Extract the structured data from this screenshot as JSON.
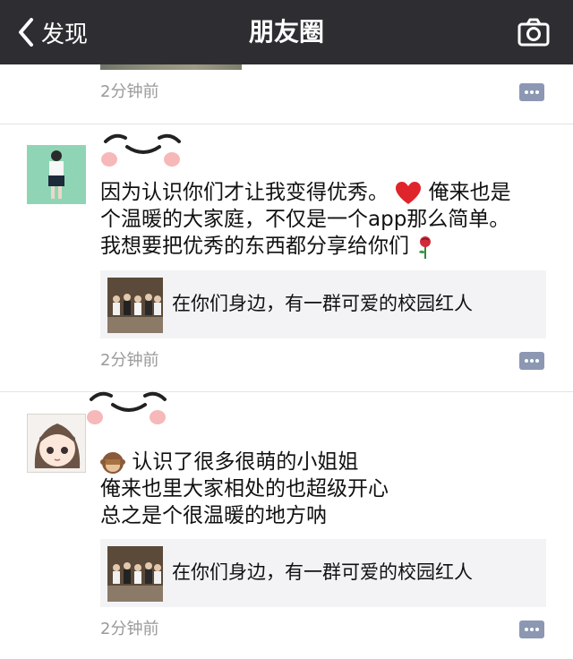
{
  "nav": {
    "back_label": "发现",
    "title": "朋友圈"
  },
  "posts": [
    {
      "time": "2分钟前"
    },
    {
      "lines": [
        "因为认识你们才让我变得优秀。",
        "俺来也是",
        "个温暖的大家庭，不仅是一个app那么简单。",
        "我想要把优秀的东西都分享给你们"
      ],
      "link": {
        "title": "在你们身边，有一群可爱的校园红人"
      },
      "time": "2分钟前"
    },
    {
      "lines": [
        "认识了很多很萌的小姐姐",
        "俺来也里大家相处的也超级开心",
        "总之是个很温暖的地方呐"
      ],
      "link": {
        "title": "在你们身边，有一群可爱的校园红人"
      },
      "time": "2分钟前"
    }
  ],
  "icons": [
    "chevron-left-icon",
    "camera-icon",
    "comment-icon",
    "heart-icon",
    "rose-icon",
    "see-no-evil-monkey-icon"
  ],
  "colors": {
    "navbar": "#2e2e32",
    "comment_button": "#8c97b3",
    "link_card": "#f3f3f5",
    "time": "#9a9a9a",
    "heart": "#e0242b"
  }
}
